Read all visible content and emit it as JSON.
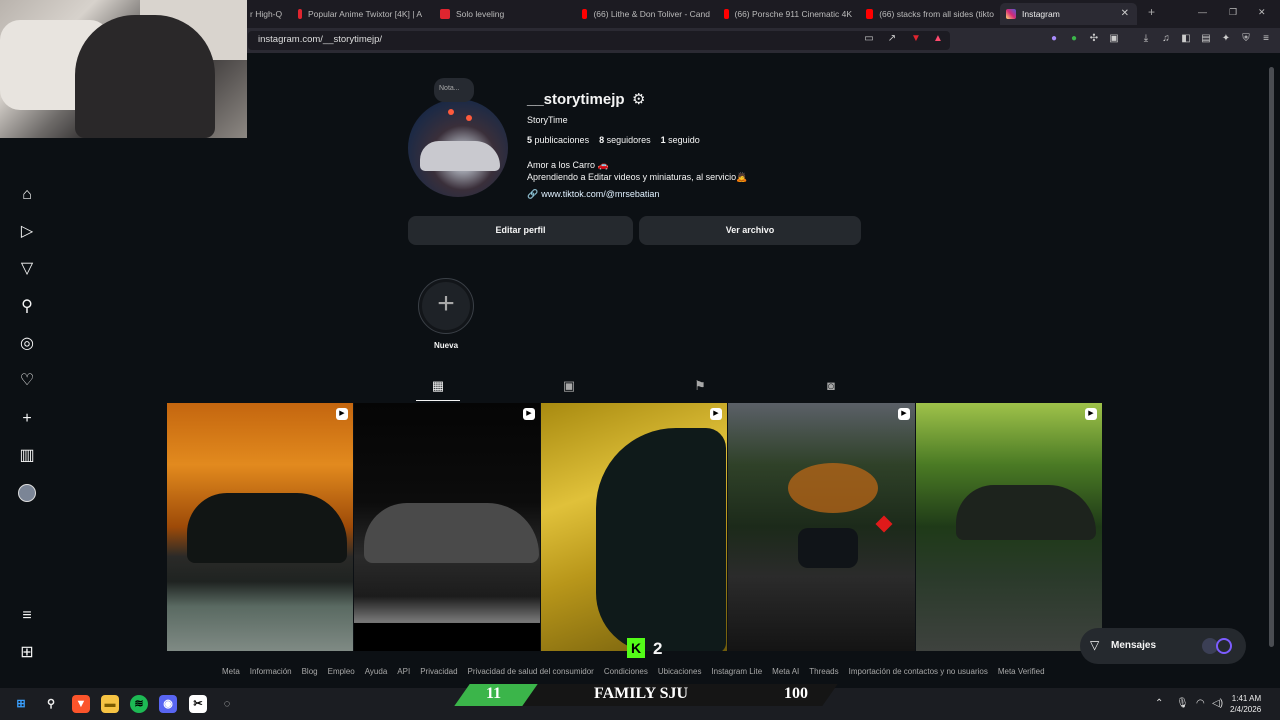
{
  "browser": {
    "tabs": [
      {
        "label": "r High-Q",
        "color": "#1c1b22"
      },
      {
        "label": "Popular Anime Twixtor [4K] | A",
        "color": "#e0252f"
      },
      {
        "label": "Solo leveling",
        "color": "#e0252f"
      },
      {
        "label": "(66) Lithe & Don Toliver - Cand",
        "color": "#ff0000"
      },
      {
        "label": "(66) Porsche 911 Cinematic 4K",
        "color": "#ff0000"
      },
      {
        "label": "(66) stacks from all sides (tikto",
        "color": "#ff0000"
      },
      {
        "label": "Instagram",
        "color": "#d6249f"
      }
    ],
    "url": "instagram.com/__storytimejp/"
  },
  "profile": {
    "note": "Nota...",
    "username": "__storytimejp",
    "full_name": "StoryTime",
    "posts_count": "5",
    "posts_label": "publicaciones",
    "followers_count": "8",
    "followers_label": "seguidores",
    "following_count": "1",
    "following_label": "seguido",
    "bio_line1": "Amor a los Carro 🚗",
    "bio_line2": "Aprendiendo a Editar videos y miniaturas, al servicio🙇",
    "link": "www.tiktok.com/@mrsebatian",
    "edit_button": "Editar perfil",
    "archive_button": "Ver archivo",
    "new_highlight": "Nueva"
  },
  "posts": [
    {
      "theme": "autumn car"
    },
    {
      "theme": "black porsche"
    },
    {
      "theme": "gold car close-up"
    },
    {
      "theme": "forest road car"
    },
    {
      "theme": "green forest car"
    }
  ],
  "footer": [
    "Meta",
    "Información",
    "Blog",
    "Empleo",
    "Ayuda",
    "API",
    "Privacidad",
    "Privacidad de salud del consumidor",
    "Condiciones",
    "Ubicaciones",
    "Instagram Lite",
    "Meta AI",
    "Threads",
    "Importación de contactos y no usuarios",
    "Meta Verified"
  ],
  "messages_label": "Mensajes",
  "kick_count": "2",
  "overlay": {
    "left": "11",
    "title": "FAMILY SJU",
    "right": "100"
  },
  "clock": {
    "time": "1:41 AM",
    "date": "2/4/2026"
  }
}
